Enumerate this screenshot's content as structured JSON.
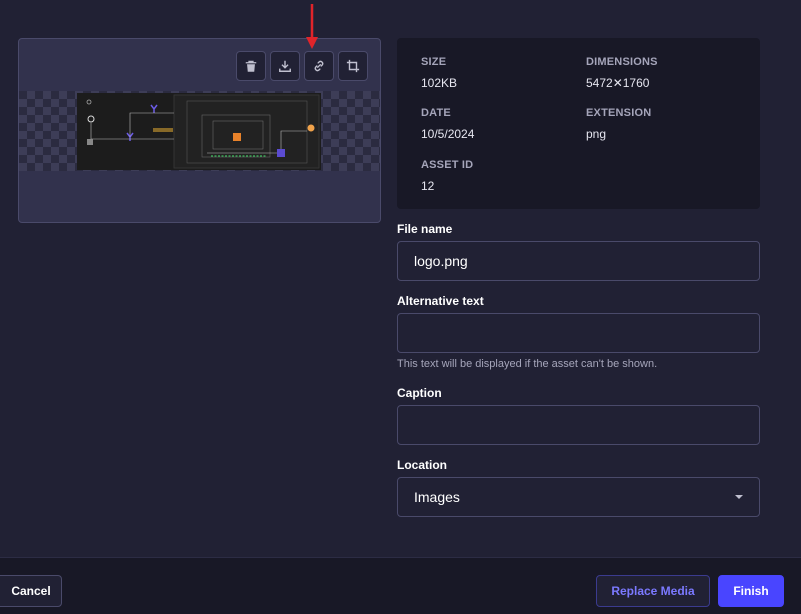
{
  "preview": {
    "actions": [
      {
        "name": "delete",
        "icon": "trash-icon"
      },
      {
        "name": "download",
        "icon": "download-icon"
      },
      {
        "name": "copy-link",
        "icon": "link-icon"
      },
      {
        "name": "crop",
        "icon": "crop-icon"
      }
    ],
    "annotation_color": "#e0242a"
  },
  "meta": {
    "size_label": "SIZE",
    "size_value": "102KB",
    "dimensions_label": "DIMENSIONS",
    "dimensions_value": "5472✕1760",
    "date_label": "DATE",
    "date_value": "10/5/2024",
    "extension_label": "EXTENSION",
    "extension_value": "png",
    "asset_id_label": "ASSET ID",
    "asset_id_value": "12"
  },
  "form": {
    "file_name_label": "File name",
    "file_name_value": "logo.png",
    "alt_text_label": "Alternative text",
    "alt_text_value": "",
    "alt_text_hint": "This text will be displayed if the asset can't be shown.",
    "caption_label": "Caption",
    "caption_value": "",
    "location_label": "Location",
    "location_value": "Images"
  },
  "footer": {
    "cancel_label": "Cancel",
    "replace_label": "Replace Media",
    "finish_label": "Finish"
  },
  "colors": {
    "background": "#212134",
    "panel": "#181826",
    "primary": "#4945ff",
    "primary_text": "#7b79ff"
  }
}
